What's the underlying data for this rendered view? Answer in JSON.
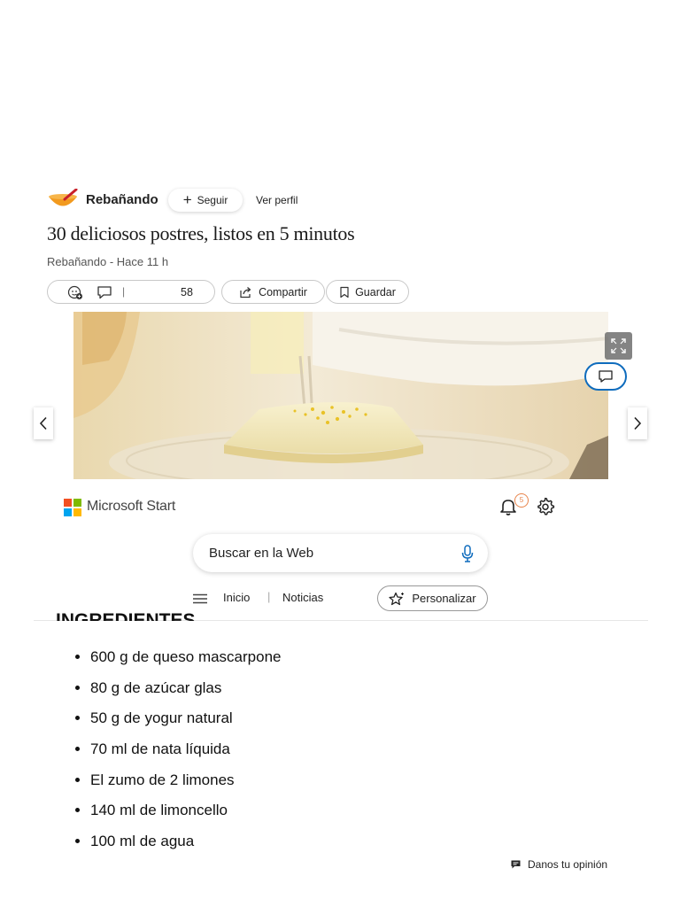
{
  "publisher": {
    "name": "Rebañando",
    "follow_label": "Seguir",
    "profile_label": "Ver perfil",
    "logo_colors": [
      "#f29a1f",
      "#c8202a"
    ]
  },
  "article": {
    "title": "30 deliciosos postres, listos en 5 minutos",
    "byline": "Rebañando - Hace 11 h"
  },
  "actions": {
    "comment_count": "58",
    "share_label": "Compartir",
    "save_label": "Guardar"
  },
  "header": {
    "brand": "Microsoft Start",
    "notification_count": "5",
    "search_placeholder": "Buscar en la Web",
    "nav": {
      "home": "Inicio",
      "news": "Noticias",
      "personalize": "Personalizar"
    },
    "logo_colors": [
      "#f25022",
      "#7fba00",
      "#00a4ef",
      "#ffb900"
    ]
  },
  "ingredients": {
    "heading": "INGREDIENTES",
    "items": [
      "600 g de queso mascarpone",
      "80 g de azúcar glas",
      "50 g de yogur natural",
      "70 ml de nata líquida",
      "El zumo de 2 limones",
      "140 ml de limoncello",
      "100 ml de agua"
    ]
  },
  "feedback_label": "Danos tu opinión"
}
